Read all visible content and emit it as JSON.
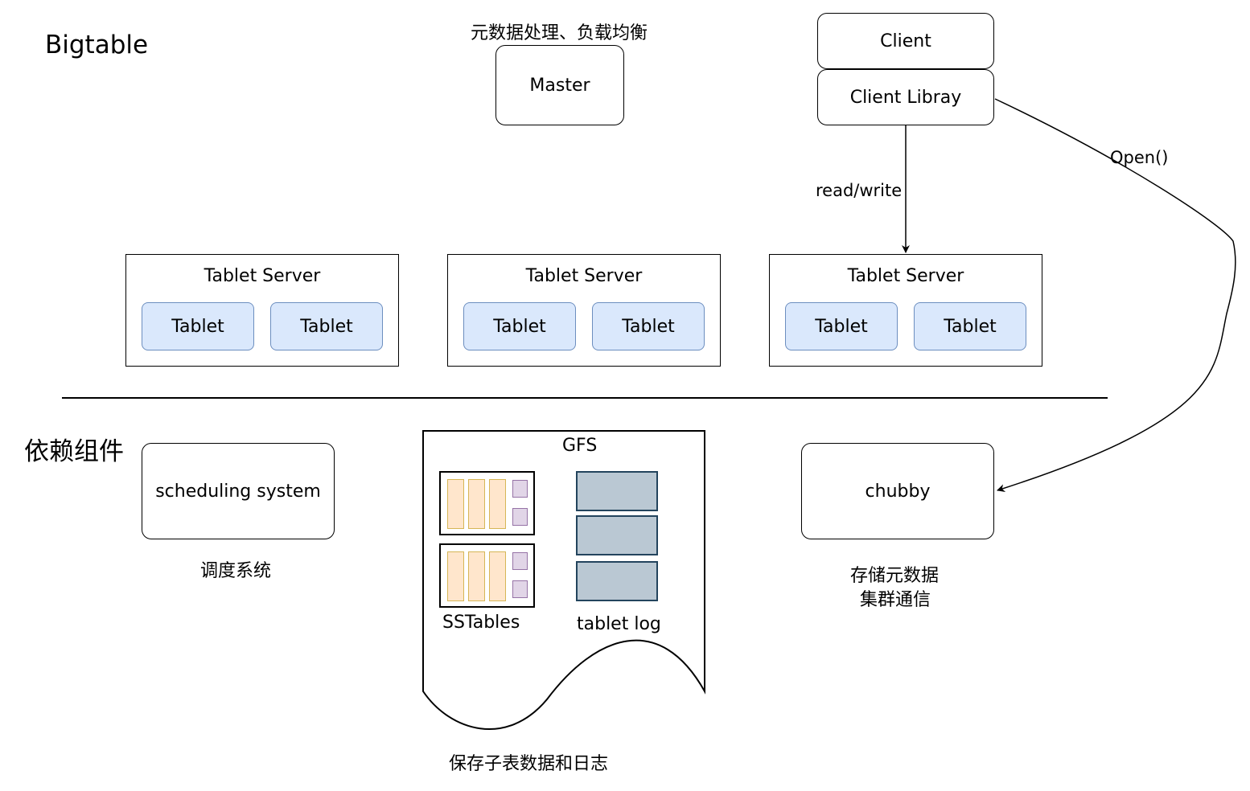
{
  "bigtable": {
    "title": "Bigtable",
    "master": {
      "label": "Master",
      "note": "元数据处理、负载均衡"
    },
    "client": {
      "label": "Client",
      "library_label": "Client Libray"
    },
    "edges": {
      "read_write": "read/write",
      "open": "Open()"
    },
    "tablet_servers": [
      {
        "label": "Tablet Server",
        "tablets": [
          "Tablet",
          "Tablet"
        ]
      },
      {
        "label": "Tablet Server",
        "tablets": [
          "Tablet",
          "Tablet"
        ]
      },
      {
        "label": "Tablet Server",
        "tablets": [
          "Tablet",
          "Tablet"
        ]
      }
    ]
  },
  "dependencies": {
    "title": "依赖组件",
    "scheduling": {
      "label": "scheduling system",
      "note": "调度系统"
    },
    "gfs": {
      "label": "GFS",
      "sstables_label": "SSTables",
      "tablet_log_label": "tablet log",
      "note": "保存子表数据和日志"
    },
    "chubby": {
      "label": "chubby",
      "note_line1": "存储元数据",
      "note_line2": "集群通信"
    }
  },
  "colors": {
    "tablet_fill": "#dae8fc",
    "tablet_stroke": "#6c8ebf",
    "sstable_cell_fill": "#ffe6cc",
    "sstable_cell_stroke": "#d6b656",
    "sstable_index_fill": "#e1d5e7",
    "sstable_index_stroke": "#9673a6",
    "log_fill": "#bac8d3",
    "log_stroke": "#23445d"
  }
}
